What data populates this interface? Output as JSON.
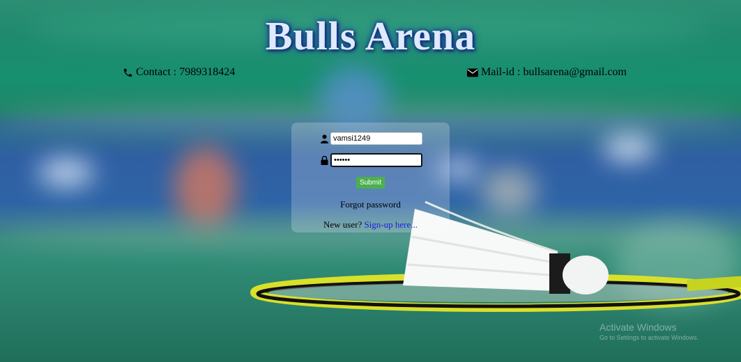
{
  "header": {
    "title": "Bulls Arena",
    "contact": "Contact : 7989318424",
    "mail": "Mail-id : bullsarena@gmail.com"
  },
  "login": {
    "username_value": "vamsi1249",
    "password_value": "••••••",
    "submit_label": "Submit",
    "forgot_label": "Forgot password",
    "new_user_text": "New user?",
    "signup_label": "Sign-up here..."
  },
  "watermark": {
    "title": "Activate Windows",
    "subtitle": "Go to Settings to activate Windows."
  },
  "colors": {
    "title_glow": "#1c3fa8",
    "submit_bg": "#4caf50",
    "link": "#1a1ae6"
  },
  "icons": {
    "phone": "phone-icon",
    "mail": "mail-icon",
    "user": "user-icon",
    "lock": "lock-icon"
  }
}
